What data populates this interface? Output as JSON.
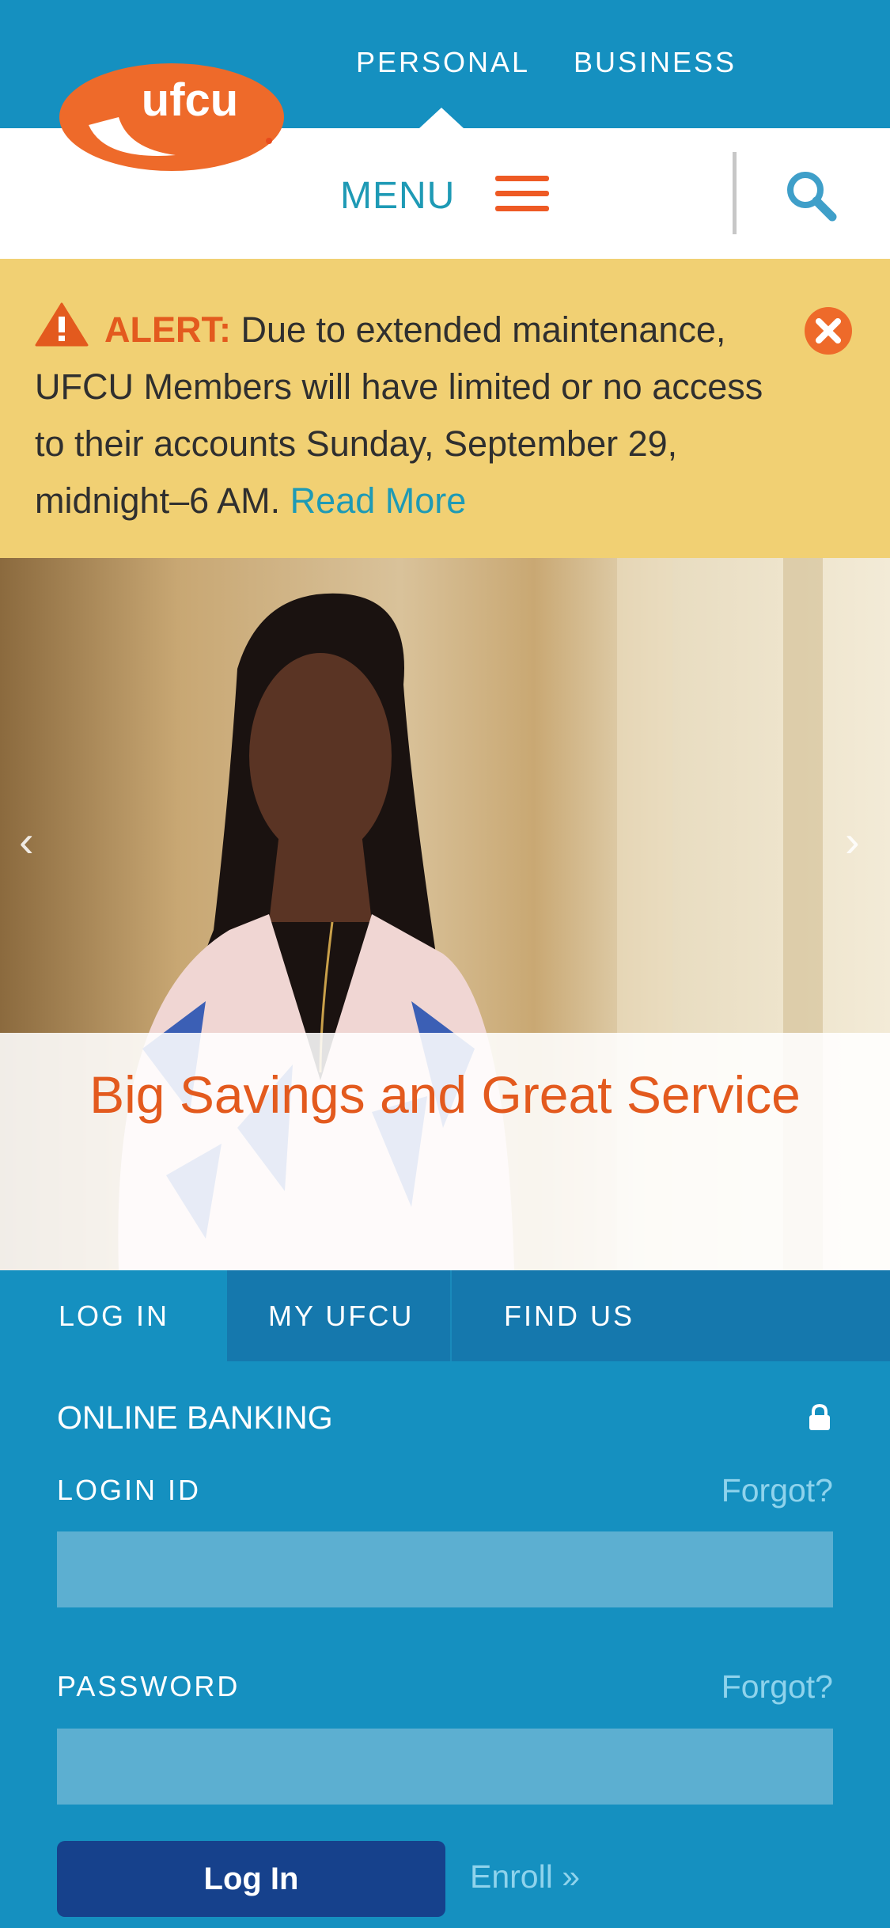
{
  "brand": {
    "logo_text": "ufcu",
    "colors": {
      "primary": "#1590c0",
      "accent": "#ee5a24",
      "alert_bg": "#f1d073"
    }
  },
  "topnav": {
    "tabs": [
      "PERSONAL",
      "BUSINESS"
    ],
    "active": "PERSONAL"
  },
  "menubar": {
    "menu_label": "MENU"
  },
  "alert": {
    "label": "ALERT:",
    "message": " Due to extended maintenance, UFCU Members will have limited or no access to their accounts Sunday, September 29, midnight–6 AM. ",
    "link": "Read More"
  },
  "hero": {
    "title": "Big Savings and Great Service",
    "prev": "‹",
    "next": "›"
  },
  "tabs": [
    "LOG IN",
    "MY UFCU",
    "FIND US"
  ],
  "login": {
    "title": "ONLINE BANKING",
    "login_id_label": "LOGIN ID",
    "password_label": "PASSWORD",
    "forgot": "Forgot?",
    "login_id_value": "",
    "password_value": "",
    "button": "Log In",
    "enroll": "Enroll »"
  }
}
